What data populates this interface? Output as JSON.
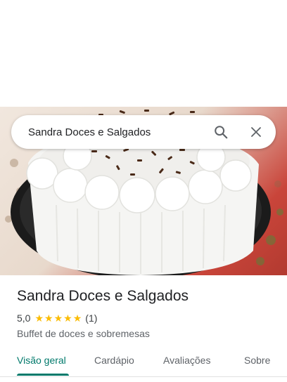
{
  "search": {
    "query": "Sandra Doces e Salgados",
    "search_icon": "search-icon",
    "close_icon": "close-icon"
  },
  "hero": {
    "image": "cake-photo"
  },
  "place": {
    "name": "Sandra Doces e Salgados",
    "rating": "5,0",
    "stars": 5,
    "review_count": "(1)",
    "category": "Buffet de doces e sobremesas"
  },
  "tabs": [
    {
      "label": "Visão geral",
      "active": true
    },
    {
      "label": "Cardápio",
      "active": false
    },
    {
      "label": "Avaliações",
      "active": false
    },
    {
      "label": "Sobre",
      "active": false
    }
  ],
  "colors": {
    "accent": "#00796b",
    "star": "#fbbc04"
  }
}
